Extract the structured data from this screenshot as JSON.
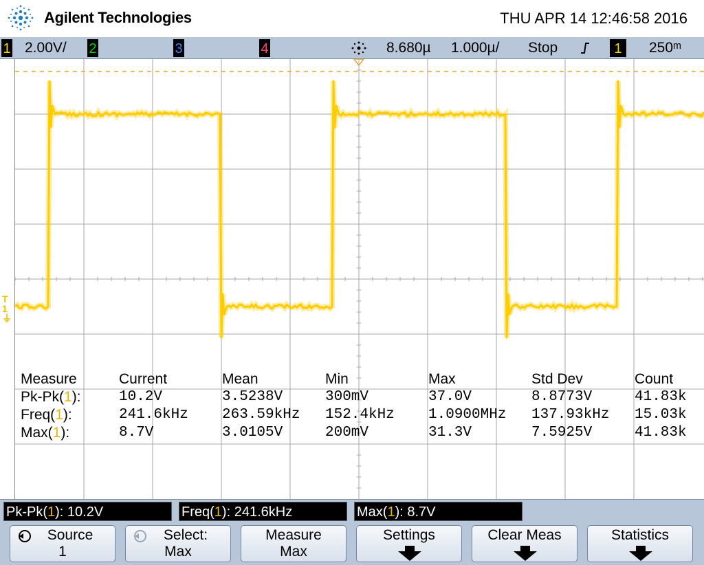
{
  "header": {
    "brand": "Agilent Technologies",
    "datetime": "THU APR 14 12:46:58 2016",
    "logo_icon": "agilent-spark-icon"
  },
  "status": {
    "ch1_num": "1",
    "ch1_scale": "2.00V/",
    "ch2_num": "2",
    "ch3_num": "3",
    "ch4_num": "4",
    "delay": "8.680µ",
    "timebase": "1.000µ/",
    "run_state": "Stop",
    "trigger_edge_icon": "rising-edge-icon",
    "trigger_source": "1",
    "trigger_level": "250ᵐ",
    "colors": {
      "ch1": "#ffd700",
      "ch2": "#00d000",
      "ch3": "#4a7bff",
      "ch4": "#ff4080"
    }
  },
  "waveform": {
    "channel": "1",
    "color": "#ffcc00",
    "high_level_divs": 3.0,
    "low_level_divs": -0.5,
    "frequency_label": "241.6kHz"
  },
  "measurements": {
    "headers": [
      "Measure",
      "Current",
      "Mean",
      "Min",
      "Max",
      "Std Dev",
      "Count"
    ],
    "rows": [
      {
        "name": "Pk-Pk(",
        "ch": "1",
        "suffix": "):",
        "current": "10.2V",
        "mean": "3.5238V",
        "min": "300mV",
        "max": "37.0V",
        "stddev": "8.8773V",
        "count": "41.83k"
      },
      {
        "name": "Freq(",
        "ch": "1",
        "suffix": "):",
        "current": "241.6kHz",
        "mean": "263.59kHz",
        "min": "152.4kHz",
        "max": "1.0900MHz",
        "stddev": "137.93kHz",
        "count": "15.03k"
      },
      {
        "name": "Max(",
        "ch": "1",
        "suffix": "):",
        "current": "8.7V",
        "mean": "3.0105V",
        "min": "200mV",
        "max": "31.3V",
        "stddev": "7.5925V",
        "count": "41.83k"
      }
    ]
  },
  "quick": [
    {
      "pre": "Pk-Pk(",
      "ch": "1",
      "post": "): 10.2V"
    },
    {
      "pre": "Freq(",
      "ch": "1",
      "post": "): 241.6kHz"
    },
    {
      "pre": "Max(",
      "ch": "1",
      "post": "): 8.7V"
    }
  ],
  "softkeys": {
    "source": {
      "l1": "Source",
      "l2": "1"
    },
    "select": {
      "l1": "Select:",
      "l2": "Max"
    },
    "measure": {
      "l1": "Measure",
      "l2": "Max"
    },
    "settings": {
      "l1": "Settings"
    },
    "clear": {
      "l1": "Clear Meas"
    },
    "statistics": {
      "l1": "Statistics"
    }
  }
}
